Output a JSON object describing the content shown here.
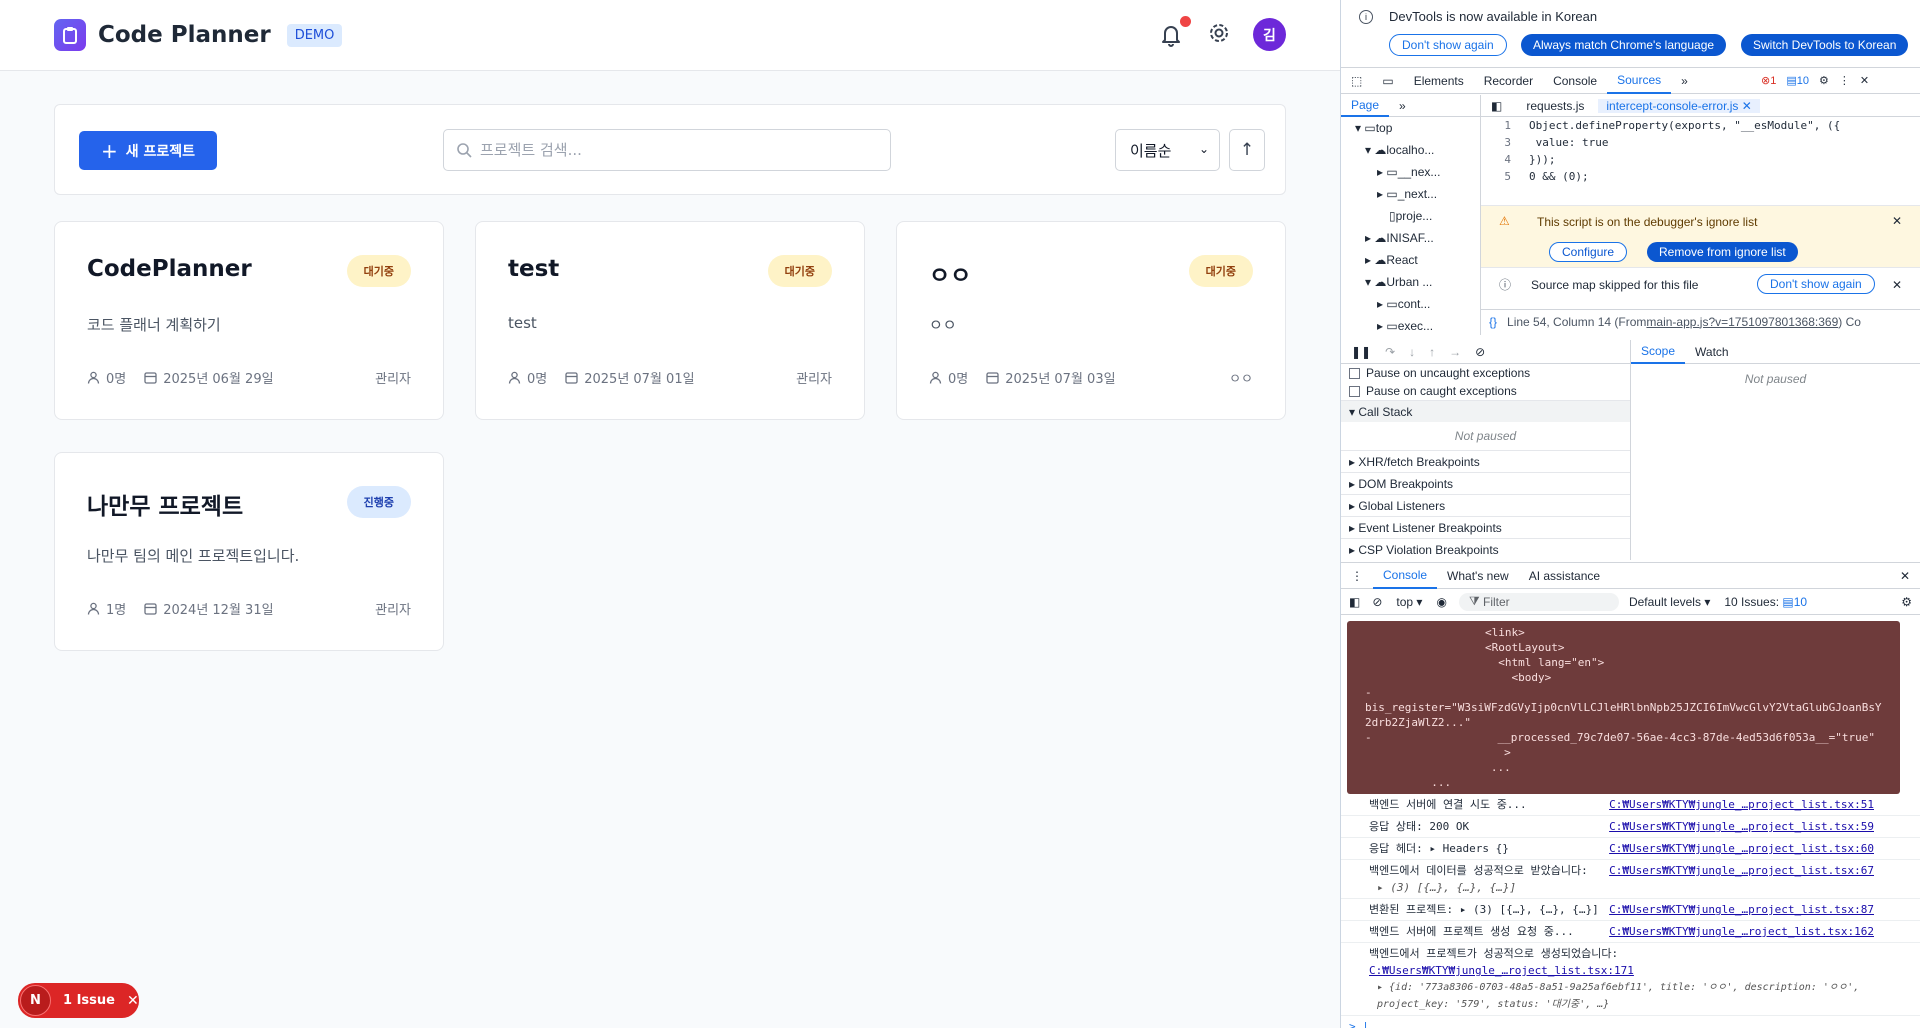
{
  "header": {
    "brand": "Code Planner",
    "badge": "DEMO",
    "avatar": "김"
  },
  "toolbar": {
    "new_button": "새 프로젝트",
    "search_placeholder": "프로젝트 검색...",
    "sort_value": "이름순",
    "sort_dir": "↑"
  },
  "projects": [
    {
      "title": "CodePlanner",
      "status": "대기중",
      "desc": "코드 플래너 계획하기",
      "members": "0명",
      "date": "2025년 06월 29일",
      "owner": "관리자"
    },
    {
      "title": "test",
      "status": "대기중",
      "desc": "test",
      "members": "0명",
      "date": "2025년 07월 01일",
      "owner": "관리자"
    },
    {
      "title": "ㅇㅇ",
      "status": "대기중",
      "desc": "ㅇㅇ",
      "members": "0명",
      "date": "2025년 07월 03일",
      "owner": "ㅇㅇ"
    },
    {
      "title": "나만무 프로젝트",
      "status": "진행중",
      "desc": "나만무 팀의 메인 프로젝트입니다.",
      "members": "1명",
      "date": "2024년 12월 31일",
      "owner": "관리자"
    }
  ],
  "issue": {
    "n": "N",
    "label": "1 Issue"
  },
  "devtools": {
    "info": "DevTools is now available in Korean",
    "btn1": "Don't show again",
    "btn2": "Always match Chrome's language",
    "btn3": "Switch DevTools to Korean",
    "tabs": [
      "Elements",
      "Recorder",
      "Console",
      "Sources"
    ],
    "err_count": "1",
    "msg_count": "10",
    "page_tab": "Page",
    "tree": [
      "top",
      "localho...",
      "__nex...",
      "_next...",
      "proje...",
      "INISAF...",
      "React",
      "Urban ...",
      "cont...",
      "exec..."
    ],
    "file_tabs": [
      "requests.js",
      "intercept-console-error.js"
    ],
    "code": [
      {
        "n": "1",
        "t": "Object.defineProperty(exports, \"__esModule\", ({"
      },
      {
        "n": "3",
        "t": "    value: true"
      },
      {
        "n": "4",
        "t": "}));"
      },
      {
        "n": "5",
        "t": "0 && (0);"
      }
    ],
    "warn": "This script is on the debugger's ignore list",
    "configure": "Configure",
    "remove": "Remove from ignore list",
    "smap": "Source map skipped for this file",
    "smap_btn": "Don't show again",
    "status_line": "Line 54, Column 14 (From ",
    "status_link": "main-app.js?v=1751097801368:369",
    "status_tail": ")  Co",
    "pause_uncaught": "Pause on uncaught exceptions",
    "pause_caught": "Pause on caught exceptions",
    "call_stack": "Call Stack",
    "not_paused": "Not paused",
    "sections": [
      "XHR/fetch Breakpoints",
      "DOM Breakpoints",
      "Global Listeners",
      "Event Listener Breakpoints",
      "CSP Violation Breakpoints"
    ],
    "scope": "Scope",
    "watch": "Watch",
    "console_tabs": [
      "Console",
      "What's new",
      "AI assistance"
    ],
    "context": "top",
    "filter": "Filter",
    "levels": "Default levels",
    "issues": "10 Issues:",
    "issues_n": "10",
    "err_lines": [
      "<link>",
      "<RootLayout>",
      "  <html lang=\"en\">",
      "    <body>",
      "-",
      "bis_register=\"W3siWFzdGVyIjp0cnVlLCJleHRlbnNpb25JZCI6ImVwcGlvY2VtaGlubGJoanBsY2drb2ZjaWlZ2...\"",
      "-                   __processed_79c7de07-56ae-4cc3-87de-4ed53d6f053a__=\"true\"",
      "                     >",
      "                   ...",
      "          ..."
    ],
    "logs": [
      {
        "m": "백엔드 서버에 연결 시도 중...",
        "s": "C:₩Users₩KTY₩jungle_…project_list.tsx:51"
      },
      {
        "m": "응답 상태: 200 OK",
        "s": "C:₩Users₩KTY₩jungle_…project_list.tsx:59"
      },
      {
        "m": "응답 헤더:  ▸ Headers {}",
        "s": "C:₩Users₩KTY₩jungle_…project_list.tsx:60"
      },
      {
        "m": "백엔드에서 데이터를 성공적으로 받았습니다:",
        "s": "C:₩Users₩KTY₩jungle_…project_list.tsx:67"
      },
      {
        "m": "변환된 프로젝트:  ▸ (3) [{…}, {…}, {…}]",
        "s": "C:₩Users₩KTY₩jungle_…project_list.tsx:87"
      },
      {
        "m": "백엔드 서버에 프로젝트 생성 요청 중...",
        "s": "C:₩Users₩KTY₩jungle_…roject_list.tsx:162"
      },
      {
        "m": "백엔드에서 프로젝트가 성공적으로 생성되었습니다:",
        "s": "C:₩Users₩KTY₩jungle_…roject_list.tsx:171"
      }
    ],
    "array_preview": "▸ (3) [{…}, {…}, {…}]",
    "obj_preview": "▸ {id: '773a8306-0703-48a5-8a51-9a25af6ebf11', title: 'ㅇㅇ', description: 'ㅇㅇ', project_key: '579', status: '대기중', …}"
  }
}
